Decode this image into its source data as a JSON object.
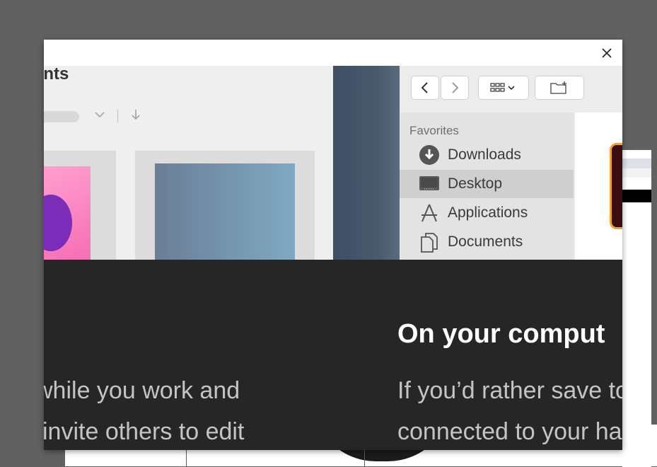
{
  "dialog": {
    "close_icon": "close-icon"
  },
  "cloud_panel": {
    "title": "ents"
  },
  "finder": {
    "favorites_label": "Favorites",
    "items": [
      {
        "label": "Downloads",
        "icon": "downloads-icon",
        "selected": false
      },
      {
        "label": "Desktop",
        "icon": "desktop-icon",
        "selected": true
      },
      {
        "label": "Applications",
        "icon": "applications-icon",
        "selected": false
      },
      {
        "label": "Documents",
        "icon": "documents-icon",
        "selected": false
      }
    ]
  },
  "caption": {
    "title": "On your comput",
    "left_line_1": "while you work and",
    "left_line_2": "invite others to edit",
    "right_line_1": "If you’d rather save to",
    "right_line_2": "connected to your ha"
  },
  "colors": {
    "backdrop": "#616161",
    "caption_bg": "#262626",
    "selected_row": "#cfcfcf",
    "folder_accent": "#f0a32a"
  }
}
